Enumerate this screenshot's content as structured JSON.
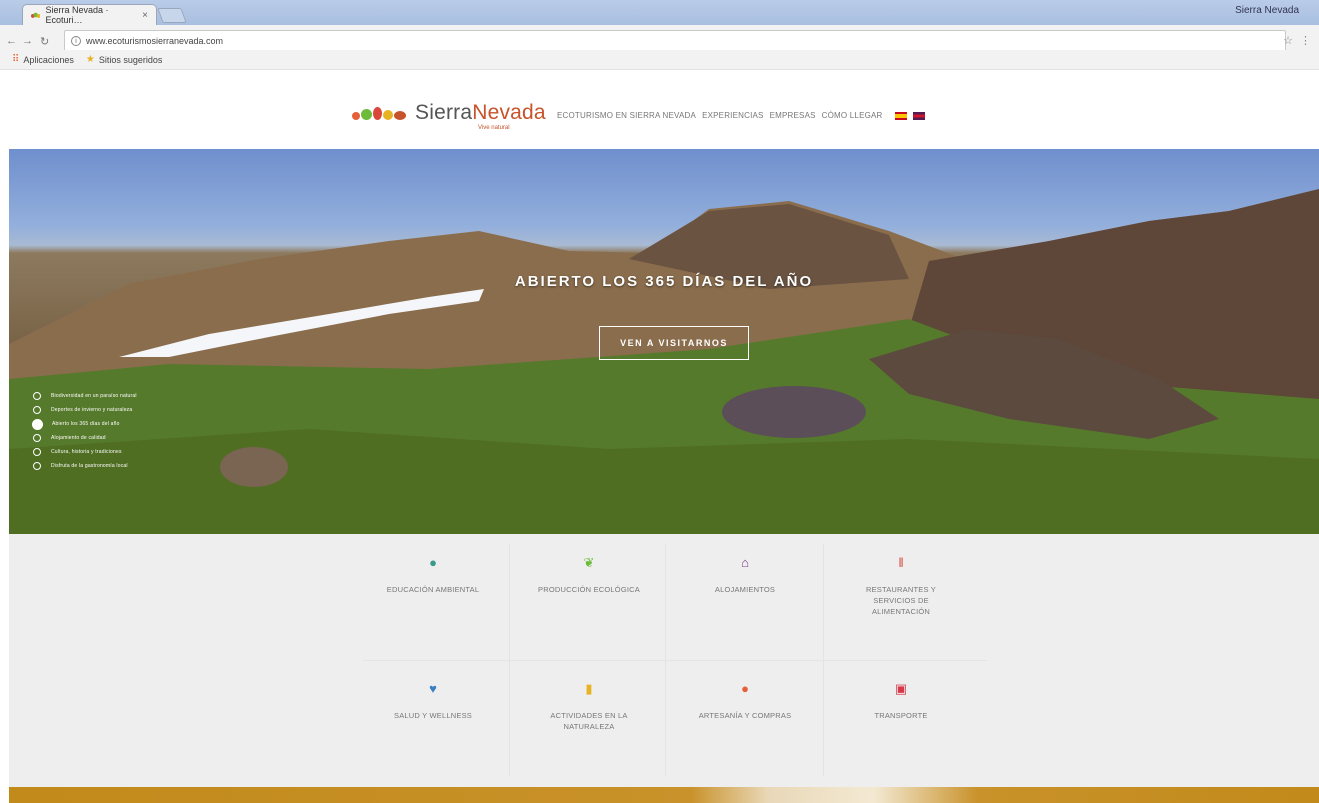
{
  "browser": {
    "tab_title": "Sierra Nevada · Ecoturi…",
    "tab_close": "×",
    "window_user": "Sierra Nevada",
    "url": "www.ecoturismosierranevada.com",
    "bookmarks": [
      {
        "label": "Aplicaciones",
        "icon": "apps-icon"
      },
      {
        "label": "Sitios sugeridos",
        "icon": "suggested-sites-icon"
      }
    ]
  },
  "site": {
    "logo": {
      "text": "Sierra",
      "text_accent": "Nevada",
      "tagline": "Vive natural"
    },
    "nav": [
      {
        "label": "ECOTURISMO EN SIERRA NEVADA"
      },
      {
        "label": "EXPERIENCIAS"
      },
      {
        "label": "EMPRESAS"
      },
      {
        "label": "CÓMO LLEGAR"
      }
    ],
    "languages": [
      "es",
      "en"
    ]
  },
  "hero": {
    "title": "ABIERTO LOS 365 DÍAS DEL AÑO",
    "cta": "VEN A VISITARNOS",
    "slides": [
      "Biodiversidad en un paraíso natural",
      "Deportes de invierno y naturaleza",
      "Abierto los 365 días del año",
      "Alojamiento de calidad",
      "Cultura, historia y tradiciones",
      "Disfruta de la gastronomía local"
    ],
    "active_slide": 2
  },
  "services": [
    {
      "label": "EDUCACIÓN AMBIENTAL",
      "icon": "drop-icon",
      "color": "#3a9a8a"
    },
    {
      "label": "PRODUCCIÓN ECOLÓGICA",
      "icon": "leaf-icon",
      "color": "#6dbb3a"
    },
    {
      "label": "ALOJAMIENTOS",
      "icon": "house-icon",
      "color": "#7a3d86"
    },
    {
      "label": "RESTAURANTES Y SERVICIOS DE ALIMENTACIÓN",
      "icon": "cutlery-icon",
      "color": "#d9463a"
    },
    {
      "label": "SALUD Y WELLNESS",
      "icon": "heart-icon",
      "color": "#3a7ec4"
    },
    {
      "label": "ACTIVIDADES EN LA NATURALEZA",
      "icon": "activity-icon",
      "color": "#e8b323"
    },
    {
      "label": "ARTESANÍA Y COMPRAS",
      "icon": "bag-icon",
      "color": "#e5603a"
    },
    {
      "label": "TRANSPORTE",
      "icon": "bus-icon",
      "color": "#d63a4a"
    }
  ]
}
